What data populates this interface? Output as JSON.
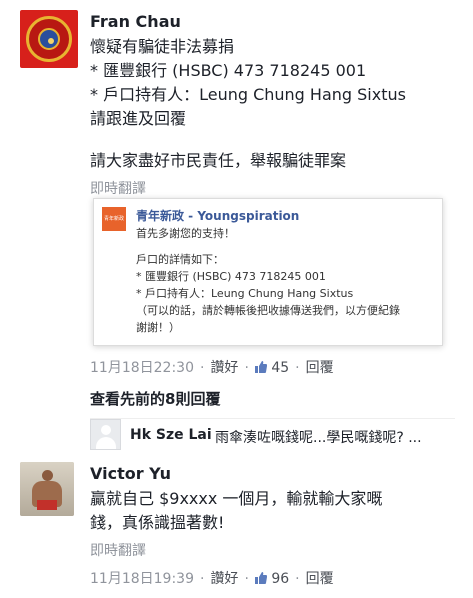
{
  "comment1": {
    "author": "Fran Chau",
    "lines": [
      "懷疑有騙徒非法募捐",
      "* 匯豐銀行 (HSBC) 473 718245 001",
      "* 戶口持有人：Leung Chung Hang Sixtus",
      "請跟進及回覆"
    ],
    "line5": "請大家盡好市民責任，舉報騙徒罪案",
    "translate": "即時翻譯",
    "embed": {
      "logo_text": "青年新政",
      "title": "青年新政 - Youngspiration",
      "lines": [
        "首先多謝您的支持！",
        "戶口的詳情如下：",
        "* 匯豐銀行 (HSBC) 473 718245 001",
        "* 戶口持有人：Leung Chung Hang Sixtus",
        "（可以的話，請於轉帳後把收據傳送我們，以方便紀錄",
        "謝謝！）"
      ]
    },
    "timestamp": "11月18日22:30",
    "like_label": "讚好",
    "like_count": "45",
    "reply_label": "回覆"
  },
  "view_previous": "查看先前的8則回覆",
  "reply_preview": {
    "author": "Hk Sze Lai",
    "text": "雨傘湊咗嘅錢呢...學民嘅錢呢? ..."
  },
  "comment2": {
    "author": "Victor Yu",
    "lines": [
      "贏就自己 $9xxxx 一個月，輸就輸大家嘅",
      "錢，真係識搵著數!"
    ],
    "translate": "即時翻譯",
    "timestamp": "11月18日19:39",
    "like_label": "讚好",
    "like_count": "96",
    "reply_label": "回覆"
  },
  "icons": {
    "like": "thumbs-up-icon",
    "default_avatar": "default-avatar-icon"
  },
  "colors": {
    "link": "#3b5998",
    "meta": "#90949c",
    "text": "#1d2129"
  }
}
